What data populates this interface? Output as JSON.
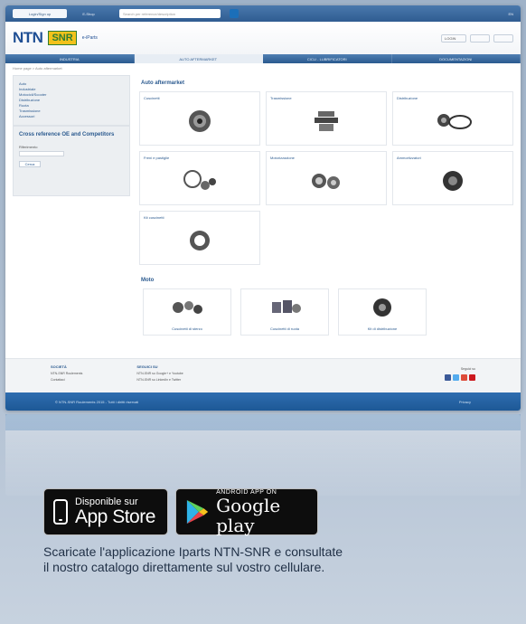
{
  "topbar": {
    "left_pill": "Login/Sign up",
    "mid_pill": "E-Shop",
    "search_placeholder": "Search per reference/description",
    "right_text": "EN"
  },
  "header": {
    "brand_ntn": "NTN",
    "brand_snr": "SNR",
    "brand_iparts": "e-iParts",
    "right_pill_1": "LOGIN",
    "right_pill_2": "",
    "right_pill_3": ""
  },
  "nav": {
    "items": [
      "INDUSTRIA",
      "AUTO AFTERMARKET",
      "CICLI - LUBRIFICATORI",
      "DOCUMENTAZIONI"
    ],
    "active_index": 1
  },
  "breadcrumb": "Home page > Auto aftermarket",
  "sidebar": {
    "links": [
      "Auto",
      "Industriale",
      "Motocicli/Scooter",
      "Distribuzione",
      "Ruota",
      "Trasmissione",
      "Accessori"
    ],
    "cross_title": "Cross reference OE and Competitors",
    "cross_label": "Riferimento",
    "cross_button": "Cerca"
  },
  "main": {
    "section1_title": "Auto aftermarket",
    "cards": [
      "Cuscinetti",
      "Trasmissione",
      "Distribuzione",
      "Freni e pastiglie",
      "Motorizzazione",
      "Ammortizzatori",
      "Kit cuscinetti"
    ],
    "section2_title": "Moto",
    "moto_cards": [
      "Cuscinetti di sterzo",
      "Cuscinetti di ruota",
      "Kit di distribuzione"
    ]
  },
  "footer": {
    "col1_title": "SOCIETÀ",
    "col1_lines": [
      "NTN-SNR Roulements",
      "Contattaci"
    ],
    "col2_title": "SEGUICI SU",
    "col2_lines": [
      "NTN-SNR su Google+ e Youtube",
      "NTN-SNR su LinkedIn e Twitter"
    ],
    "social_title": "Seguici su",
    "bottom_left": "© NTN-SNR Roulements 2015 - Tutti i diritti riservati",
    "bottom_right": "Privacy"
  },
  "badges": {
    "apple_small": "Disponible sur",
    "apple_big": "App Store",
    "google_small": "ANDROID APP ON",
    "google_big": "Google play"
  },
  "caption_line1": "Scaricate l'applicazione Iparts NTN-SNR e consultate",
  "caption_line2": "il nostro catalogo direttamente sul vostro cellulare."
}
